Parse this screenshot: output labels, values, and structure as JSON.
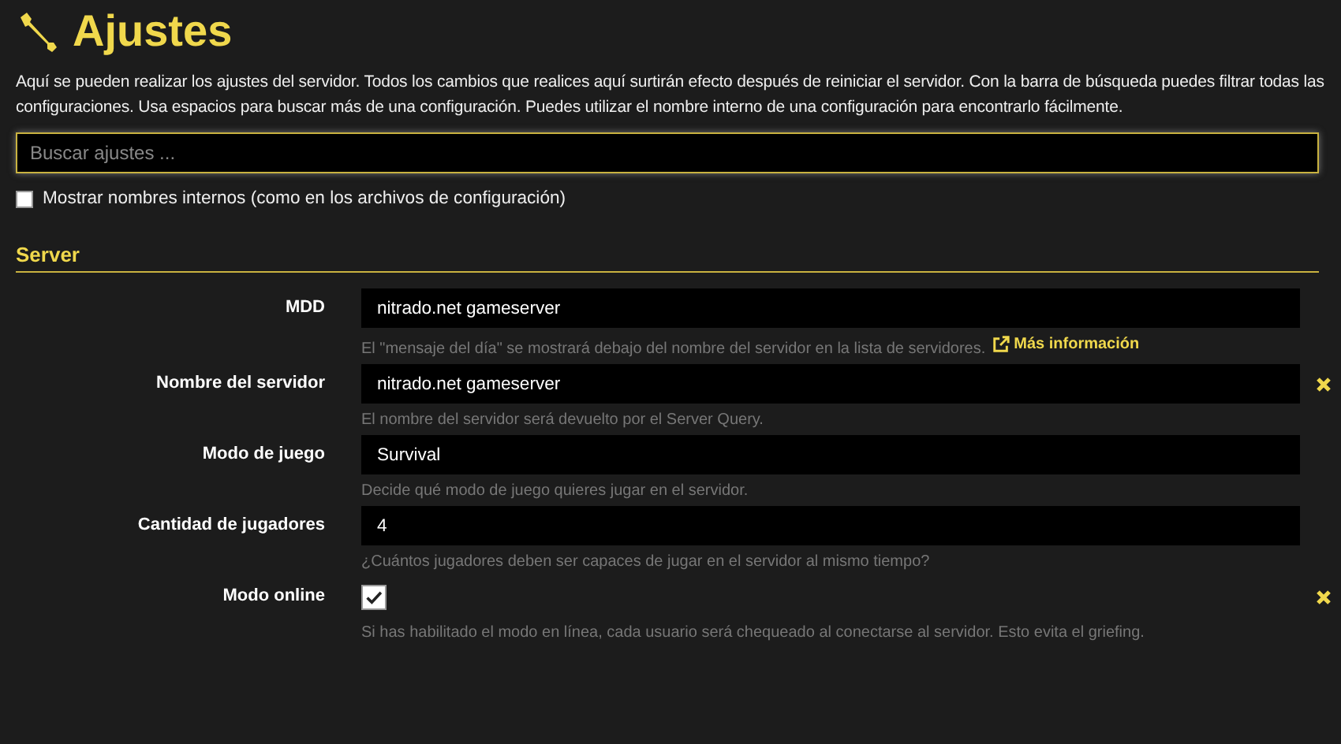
{
  "page": {
    "title": "Ajustes",
    "intro": "Aquí se pueden realizar los ajustes del servidor. Todos los cambios que realices aquí surtirán efecto después de reiniciar el servidor. Con la barra de búsqueda puedes filtrar todas las configuraciones. Usa espacios para buscar más de una configuración. Puedes utilizar el nombre interno de una configuración para encontrarlo fácilmente."
  },
  "search": {
    "placeholder": "Buscar ajustes ..."
  },
  "show_internal_names": {
    "label": "Mostrar nombres internos (como en los archivos de configuración)",
    "checked": false
  },
  "section": {
    "title": "Server",
    "settings": [
      {
        "kind": "text",
        "label": "MDD",
        "value": "nitrado.net gameserver",
        "help": "El \"mensaje del día\" se mostrará debajo del nombre del servidor en la lista de servidores.",
        "link": "Más información",
        "modified": false
      },
      {
        "kind": "text",
        "label": "Nombre del servidor",
        "value": "nitrado.net gameserver",
        "help": "El nombre del servidor será devuelto por el Server Query.",
        "modified": true
      },
      {
        "kind": "text",
        "label": "Modo de juego",
        "value": "Survival",
        "help": "Decide qué modo de juego quieres jugar en el servidor.",
        "modified": false
      },
      {
        "kind": "text",
        "label": "Cantidad de jugadores",
        "value": "4",
        "help": "¿Cuántos jugadores deben ser capaces de jugar en el servidor al mismo tiempo?",
        "modified": false
      },
      {
        "kind": "checkbox",
        "label": "Modo online",
        "checked": true,
        "help": "Si has habilitado el modo en línea, cada usuario será chequeado al conectarse al servidor. Esto evita el griefing.",
        "modified": true
      }
    ]
  }
}
